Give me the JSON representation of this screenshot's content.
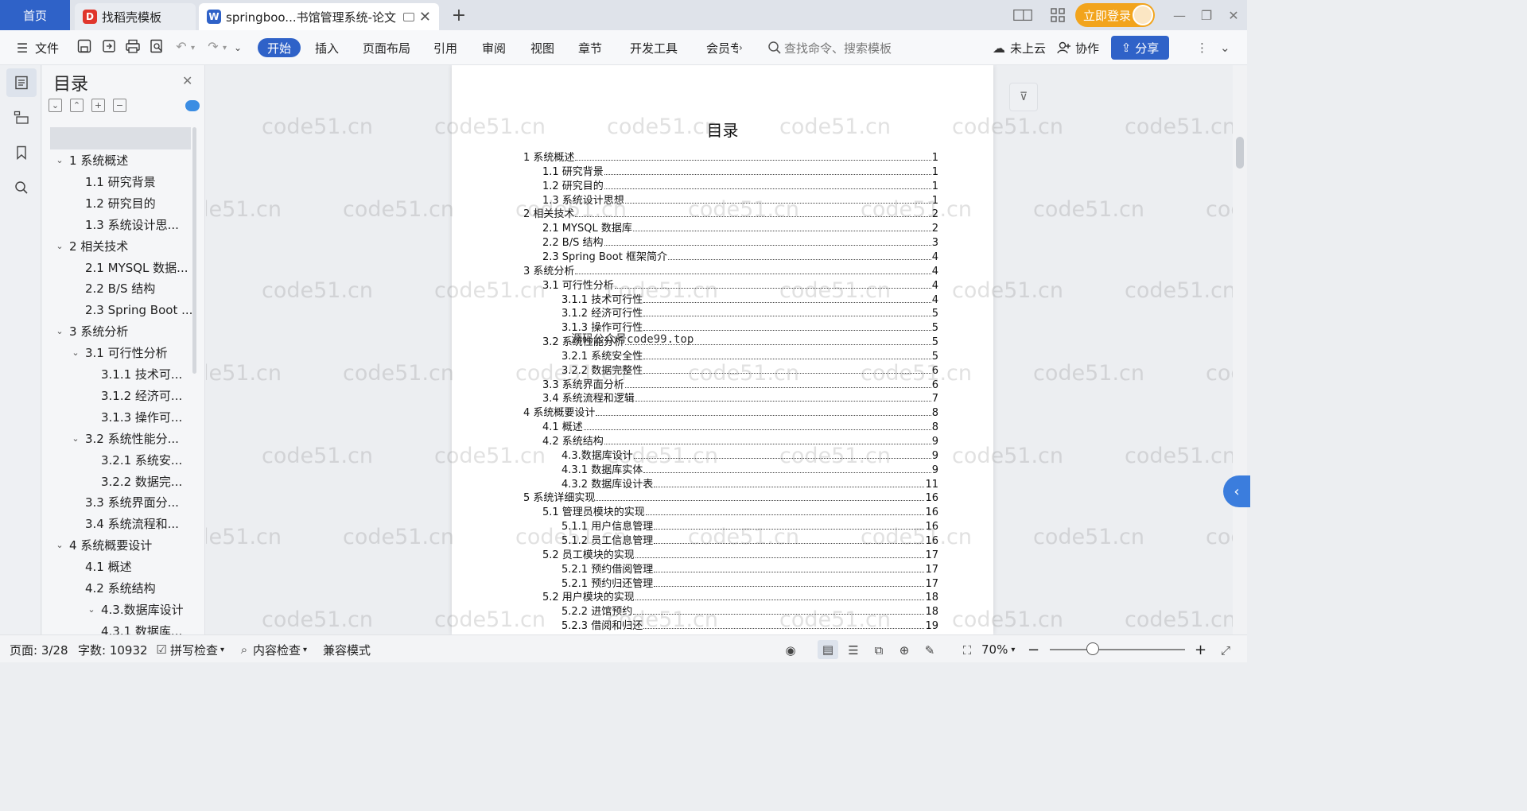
{
  "tabs": {
    "home": "首页",
    "t1": "找稻壳模板",
    "t2": "springboo...书馆管理系统-论文",
    "login": "立即登录"
  },
  "ribbon": {
    "file": "文件",
    "start": "开始",
    "insert": "插入",
    "layout": "页面布局",
    "ref": "引用",
    "review": "审阅",
    "view": "视图",
    "chapter": "章节",
    "dev": "开发工具",
    "member": "会员专",
    "search": "查找命令、搜索模板",
    "cloud": "未上云",
    "collab": "协作",
    "share": "分享"
  },
  "toc_panel": {
    "title": "目录",
    "items": [
      {
        "label": "1 系统概述",
        "chev": "⌄"
      },
      {
        "label": "1.1  研究背景",
        "chev": ""
      },
      {
        "label": "1.2 研究目的",
        "chev": ""
      },
      {
        "label": "1.3 系统设计思...",
        "chev": ""
      },
      {
        "label": "2 相关技术",
        "chev": "⌄"
      },
      {
        "label": "2.1 MYSQL 数据...",
        "chev": ""
      },
      {
        "label": "2.2 B/S 结构",
        "chev": ""
      },
      {
        "label": "2.3 Spring Boot ...",
        "chev": ""
      },
      {
        "label": "3 系统分析",
        "chev": "⌄"
      },
      {
        "label": "3.1 可行性分析",
        "chev": "⌄"
      },
      {
        "label": "3.1.1 技术可...",
        "chev": ""
      },
      {
        "label": "3.1.2 经济可...",
        "chev": ""
      },
      {
        "label": "3.1.3 操作可...",
        "chev": ""
      },
      {
        "label": "3.2 系统性能分...",
        "chev": "⌄"
      },
      {
        "label": "3.2.1  系统安...",
        "chev": ""
      },
      {
        "label": "3.2.2  数据完...",
        "chev": ""
      },
      {
        "label": "3.3 系统界面分...",
        "chev": ""
      },
      {
        "label": "3.4 系统流程和...",
        "chev": ""
      },
      {
        "label": "4 系统概要设计",
        "chev": "⌄"
      },
      {
        "label": "4.1 概述",
        "chev": ""
      },
      {
        "label": "4.2 系统结构",
        "chev": ""
      },
      {
        "label": "4.3.数据库设计",
        "chev": "⌄"
      },
      {
        "label": "4.3.1 数据库...",
        "chev": ""
      }
    ]
  },
  "document": {
    "heading": "目录",
    "page_mark": "源码公众号code99.top",
    "entries": [
      {
        "t": "1 系统概述",
        "p": "1"
      },
      {
        "t": "1.1  研究背景",
        "p": "1"
      },
      {
        "t": "1.2 研究目的",
        "p": "1"
      },
      {
        "t": "1.3 系统设计思想",
        "p": "1"
      },
      {
        "t": "2 相关技术",
        "p": "2"
      },
      {
        "t": "2.1 MYSQL 数据库",
        "p": "2"
      },
      {
        "t": "2.2 B/S 结构",
        "p": "3"
      },
      {
        "t": "2.3 Spring Boot 框架简介",
        "p": "4"
      },
      {
        "t": "3 系统分析",
        "p": "4"
      },
      {
        "t": "3.1 可行性分析",
        "p": "4"
      },
      {
        "t": "3.1.1 技术可行性",
        "p": "4"
      },
      {
        "t": "3.1.2 经济可行性",
        "p": "5"
      },
      {
        "t": "3.1.3 操作可行性",
        "p": "5"
      },
      {
        "t": "3.2 系统性能分析",
        "p": "5"
      },
      {
        "t": "3.2.1  系统安全性",
        "p": "5"
      },
      {
        "t": "3.2.2  数据完整性",
        "p": "6"
      },
      {
        "t": "3.3 系统界面分析",
        "p": "6"
      },
      {
        "t": "3.4 系统流程和逻辑",
        "p": "7"
      },
      {
        "t": "4 系统概要设计",
        "p": "8"
      },
      {
        "t": "4.1 概述",
        "p": "8"
      },
      {
        "t": "4.2 系统结构",
        "p": "9"
      },
      {
        "t": "4.3.数据库设计",
        "p": "9"
      },
      {
        "t": "4.3.1 数据库实体",
        "p": "9"
      },
      {
        "t": "4.3.2 数据库设计表",
        "p": "11"
      },
      {
        "t": "5 系统详细实现",
        "p": "16"
      },
      {
        "t": "5.1  管理员模块的实现",
        "p": "16"
      },
      {
        "t": "5.1.1  用户信息管理",
        "p": "16"
      },
      {
        "t": "5.1.2  员工信息管理",
        "p": "16"
      },
      {
        "t": "5.2  员工模块的实现",
        "p": "17"
      },
      {
        "t": "5.2.1  预约借阅管理",
        "p": "17"
      },
      {
        "t": "5.2.1  预约归还管理",
        "p": "17"
      },
      {
        "t": "5.2  用户模块的实现",
        "p": "18"
      },
      {
        "t": "5.2.2  进馆预约",
        "p": "18"
      },
      {
        "t": "5.2.3  借阅和归还",
        "p": "19"
      }
    ]
  },
  "watermark": "code51.cn",
  "status": {
    "page": "页面: 3/28",
    "words": "字数: 10932",
    "spell": "拼写检查",
    "content": "内容检查",
    "compat": "兼容模式",
    "zoom": "70%"
  },
  "colors": {
    "accent": "#2f62c8",
    "login": "#f2a41c"
  }
}
